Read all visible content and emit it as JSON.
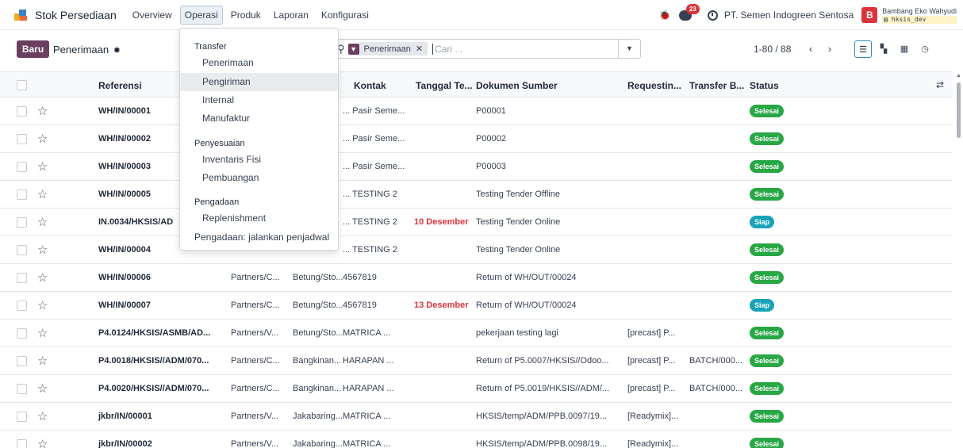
{
  "navbar": {
    "app_name": "Stok Persediaan",
    "menu": [
      "Overview",
      "Operasi",
      "Produk",
      "Laporan",
      "Konfigurasi"
    ],
    "active_menu": "Operasi",
    "chat_badge": "23",
    "company": "PT. Semen Indogreen Sentosa",
    "avatar_letter": "B",
    "user_name": "Bambang Eko Wahyudi",
    "database": "hksis_dev"
  },
  "control": {
    "new_button": "Baru",
    "breadcrumb": "Penerimaan",
    "facet": "Penerimaan",
    "search_placeholder": "Cari ...",
    "pager": "1-80 / 88"
  },
  "dropdown": {
    "sections": [
      {
        "title": "Transfer",
        "items": [
          "Penerimaan",
          "Pengiriman",
          "Internal",
          "Manufaktur"
        ]
      },
      {
        "title": "Penyesuaian",
        "items": [
          "Inventaris Fisi",
          "Pembuangan"
        ]
      },
      {
        "title": "Pengadaan",
        "items": [
          "Replenishment"
        ]
      }
    ],
    "extra_item": "Pengadaan: jalankan penjadwal",
    "hovered_item": "Pengiriman"
  },
  "table": {
    "headers": [
      "Referensi",
      "Kontak",
      "Tanggal Te...",
      "Dokumen Sumber",
      "Requestin...",
      "Transfer B...",
      "Status"
    ],
    "rows": [
      {
        "ref": "WH/IN/00001",
        "from": "",
        "to": "",
        "contact": "... Pasir Seme...",
        "date": "",
        "source": "P00001",
        "req": "",
        "batch": "",
        "status": "Selesai"
      },
      {
        "ref": "WH/IN/00002",
        "from": "",
        "to": "",
        "contact": "... Pasir Seme...",
        "date": "",
        "source": "P00002",
        "req": "",
        "batch": "",
        "status": "Selesai"
      },
      {
        "ref": "WH/IN/00003",
        "from": "",
        "to": "",
        "contact": "... Pasir Seme...",
        "date": "",
        "source": "P00003",
        "req": "",
        "batch": "",
        "status": "Selesai"
      },
      {
        "ref": "WH/IN/00005",
        "from": "",
        "to": "",
        "contact": "... TESTING 2",
        "date": "",
        "source": "Testing Tender Offline",
        "req": "",
        "batch": "",
        "status": "Selesai"
      },
      {
        "ref": "IN.0034/HKSIS/AD",
        "from": "",
        "to": "",
        "contact": "... TESTING 2",
        "date": "10 Desember",
        "source": "Testing Tender Online",
        "req": "",
        "batch": "",
        "status": "Siap"
      },
      {
        "ref": "WH/IN/00004",
        "from": "",
        "to": "",
        "contact": "... TESTING 2",
        "date": "",
        "source": "Testing Tender Online",
        "req": "",
        "batch": "",
        "status": "Selesai"
      },
      {
        "ref": "WH/IN/00006",
        "from": "Partners/C...",
        "to": "Betung/Sto...",
        "contact": "4567819",
        "date": "",
        "source": "Return of WH/OUT/00024",
        "req": "",
        "batch": "",
        "status": "Selesai"
      },
      {
        "ref": "WH/IN/00007",
        "from": "Partners/C...",
        "to": "Betung/Sto...",
        "contact": "4567819",
        "date": "13 Desember",
        "source": "Return of WH/OUT/00024",
        "req": "",
        "batch": "",
        "status": "Siap"
      },
      {
        "ref": "P4.0124/HKSIS/ASMB/AD...",
        "from": "Partners/V...",
        "to": "Betung/Sto...",
        "contact": "MATRICA ...",
        "date": "",
        "source": "pekerjaan testing lagi",
        "req": "[precast] P...",
        "batch": "",
        "status": "Selesai"
      },
      {
        "ref": "P4.0018/HKSIS//ADM/070...",
        "from": "Partners/C...",
        "to": "Bangkinan...",
        "contact": "HARAPAN ...",
        "date": "",
        "source": "Return of P5.0007/HKSIS//Odoo...",
        "req": "[precast] P...",
        "batch": "BATCH/000...",
        "status": "Selesai"
      },
      {
        "ref": "P4.0020/HKSIS//ADM/070...",
        "from": "Partners/C...",
        "to": "Bangkinan...",
        "contact": "HARAPAN ...",
        "date": "",
        "source": "Return of P5.0019/HKSIS//ADM/...",
        "req": "[precast] P...",
        "batch": "BATCH/000...",
        "status": "Selesai"
      },
      {
        "ref": "jkbr/IN/00001",
        "from": "Partners/V...",
        "to": "Jakabaring...",
        "contact": "MATRICA ...",
        "date": "",
        "source": "HKSIS/temp/ADM/PPB.0097/19...",
        "req": "[Readymix]...",
        "batch": "",
        "status": "Selesai"
      },
      {
        "ref": "jkbr/IN/00002",
        "from": "Partners/V...",
        "to": "Jakabaring...",
        "contact": "MATRICA ...",
        "date": "",
        "source": "HKSIS/temp/ADM/PPB.0098/19...",
        "req": "[Readymix]...",
        "batch": "",
        "status": "Selesai"
      }
    ]
  },
  "colors": {
    "primary": "#6b3f5f",
    "done": "#28a745",
    "ready": "#17a2b8",
    "overdue": "#d9343a"
  },
  "icons": [
    "app-icon",
    "bug-icon",
    "chat-icon",
    "clock-icon",
    "gear-icon",
    "search-icon",
    "filter-icon",
    "close-icon",
    "chevron-down-icon",
    "chevron-left-icon",
    "chevron-right-icon",
    "list-view-icon",
    "kanban-view-icon",
    "calendar-view-icon",
    "activity-view-icon",
    "star-icon",
    "column-settings-icon"
  ]
}
